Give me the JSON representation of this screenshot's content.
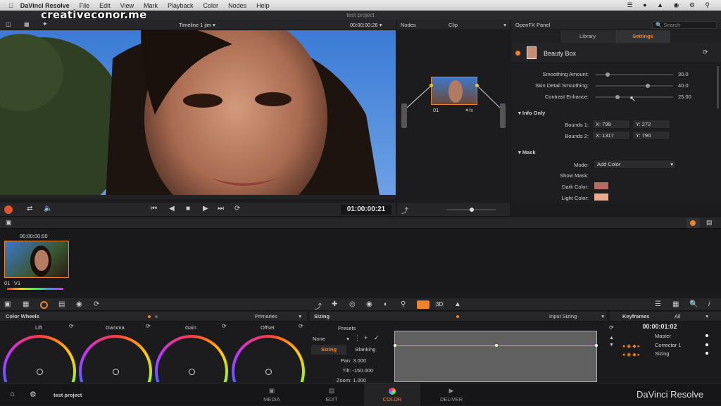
{
  "menubar": {
    "app": "DaVinci Resolve",
    "items": [
      "File",
      "Edit",
      "View",
      "Mark",
      "Playback",
      "Color",
      "Nodes",
      "Help"
    ]
  },
  "watermark": "creativeconor.me",
  "window_title": "test project",
  "viewer": {
    "timeline_label": "Timeline 1 jim",
    "timecode_top": "00:00:00:26",
    "timecode": "01:00:00:21"
  },
  "nodes": {
    "header": "Nodes",
    "clip_label": "Clip",
    "node_label": "01"
  },
  "openfx": {
    "header": "OpenFX Panel",
    "search_placeholder": "Search",
    "tab_library": "Library",
    "tab_settings": "Settings",
    "plugin": "Beauty Box",
    "params": [
      {
        "label": "Smoothing Amount:",
        "value": "30.0",
        "level": 0.13
      },
      {
        "label": "Skin Detail Smoothing:",
        "value": "40.0",
        "level": 0.68
      },
      {
        "label": "Contrast Enhance:",
        "value": "25.00",
        "level": 0.27
      }
    ],
    "info_section": "Info Only",
    "bounds1_label": "Bounds 1:",
    "bounds1_x": "X: 799",
    "bounds1_y": "Y: 272",
    "bounds2_label": "Bounds 2:",
    "bounds2_x": "X: 1317",
    "bounds2_y": "Y: 790",
    "mask_section": "Mask",
    "mode_label": "Mode:",
    "mode_value": "Add Color",
    "show_mask_label": "Show Mask:",
    "dark_color_label": "Dark Color:",
    "light_color_label": "Light Color:",
    "dark_color": "#b86a64",
    "light_color": "#e9a98e"
  },
  "timeline": {
    "timecode": "00:00:00:00",
    "clip_label": "01",
    "track_label": "V1"
  },
  "color_wheels": {
    "header": "Color Wheels",
    "mode": "Primaries",
    "wheels": [
      "Lift",
      "Gamma",
      "Gain",
      "Offset"
    ]
  },
  "sizing": {
    "header": "Sizing",
    "mode": "Input Sizing",
    "presets_label": "Presets",
    "preset_value": "None",
    "tab_sizing": "Sizing",
    "tab_blanking": "Blanking",
    "pan": "Pan: 3.000",
    "tilt": "Tilt: -150.000",
    "zoom": "Zoom: 1.000"
  },
  "keyframes": {
    "header": "Keyframes",
    "filter": "All",
    "timecode": "00:00:01:02",
    "tracks": [
      "Master",
      "Corrector 1",
      "Sizing"
    ]
  },
  "bottom": {
    "project": "test project",
    "tabs": [
      "MEDIA",
      "EDIT",
      "COLOR",
      "DELIVER"
    ],
    "brand": "DaVinci Resolve"
  },
  "colors": {
    "accent": "#f0822a"
  }
}
